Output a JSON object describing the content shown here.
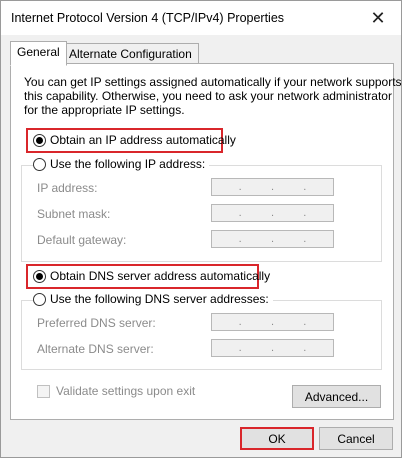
{
  "window": {
    "title": "Internet Protocol Version 4 (TCP/IPv4) Properties"
  },
  "tabs": [
    {
      "label": "General"
    },
    {
      "label": "Alternate Configuration"
    }
  ],
  "description": [
    "You can get IP settings assigned automatically if your network supports",
    "this capability. Otherwise, you need to ask your network administrator",
    "for the appropriate IP settings."
  ],
  "ip": {
    "auto_label": "Obtain an IP address automatically",
    "auto_selected": true,
    "manual_label": "Use the following IP address:",
    "manual_selected": false,
    "fields": [
      {
        "label": "IP address:",
        "value": ". . ."
      },
      {
        "label": "Subnet mask:",
        "value": ". . ."
      },
      {
        "label": "Default gateway:",
        "value": ". . ."
      }
    ]
  },
  "dns": {
    "auto_label": "Obtain DNS server address automatically",
    "auto_selected": true,
    "manual_label": "Use the following DNS server addresses:",
    "manual_selected": false,
    "fields": [
      {
        "label": "Preferred DNS server:",
        "value": ". . ."
      },
      {
        "label": "Alternate DNS server:",
        "value": ". . ."
      }
    ]
  },
  "validate": {
    "label": "Validate settings upon exit",
    "checked": false
  },
  "buttons": {
    "advanced": "Advanced...",
    "ok": "OK",
    "cancel": "Cancel"
  },
  "colors": {
    "highlight": "#d9262b",
    "disabled_text": "#8b8b8b"
  }
}
